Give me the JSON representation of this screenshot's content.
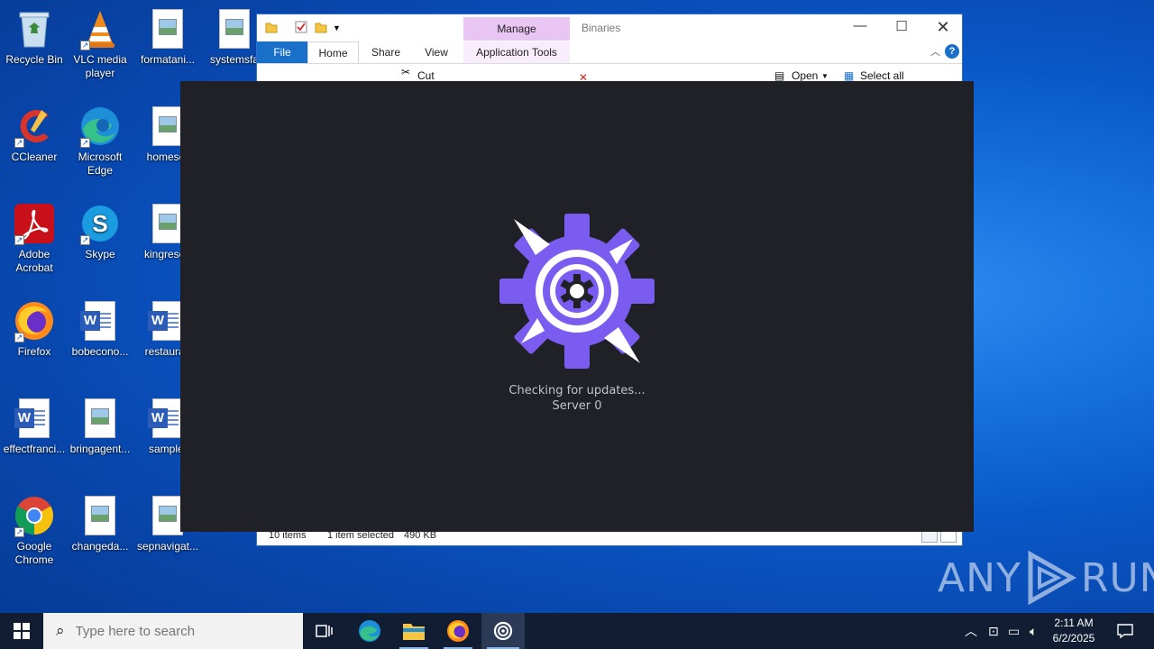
{
  "desktop": {
    "icons": [
      {
        "label": "Recycle Bin",
        "icon": "recycle-bin-icon"
      },
      {
        "label": "VLC media player",
        "icon": "vlc-icon"
      },
      {
        "label": "formatani...",
        "icon": "image-file-icon"
      },
      {
        "label": "systemsfa",
        "icon": "image-file-icon"
      },
      {
        "label": "CCleaner",
        "icon": "ccleaner-icon"
      },
      {
        "label": "Microsoft Edge",
        "icon": "edge-icon"
      },
      {
        "label": "homeser",
        "icon": "image-file-icon"
      },
      {
        "label": "Adobe Acrobat",
        "icon": "acrobat-icon"
      },
      {
        "label": "Skype",
        "icon": "skype-icon"
      },
      {
        "label": "kingresea",
        "icon": "image-file-icon"
      },
      {
        "label": "Firefox",
        "icon": "firefox-icon"
      },
      {
        "label": "bobecono...",
        "icon": "word-doc-icon"
      },
      {
        "label": "restauran",
        "icon": "word-doc-icon"
      },
      {
        "label": "effectfranci...",
        "icon": "word-doc-icon"
      },
      {
        "label": "bringagent...",
        "icon": "image-file-icon"
      },
      {
        "label": "samplef",
        "icon": "word-doc-icon"
      },
      {
        "label": "Google Chrome",
        "icon": "chrome-icon"
      },
      {
        "label": "changeda...",
        "icon": "image-file-icon"
      },
      {
        "label": "sepnavigat...",
        "icon": "image-file-icon"
      }
    ]
  },
  "explorer": {
    "title": "Binaries",
    "manage_tab": "Manage",
    "tabs": {
      "file": "File",
      "home": "Home",
      "share": "Share",
      "view": "View",
      "app_tools": "Application Tools"
    },
    "ribbon": {
      "cut": "Cut",
      "open": "Open",
      "select_all": "Select all"
    },
    "status": {
      "items": "10 items",
      "selected": "1 item selected",
      "size": "490 KB"
    }
  },
  "splash": {
    "status_line": "Checking for updates...",
    "server_line": "Server 0",
    "colors": {
      "background": "#1f2126",
      "logo": "#7b5cf0"
    }
  },
  "watermark": {
    "left": "ANY",
    "right": "RUN"
  },
  "taskbar": {
    "search_placeholder": "Type here to search",
    "time": "2:11 AM",
    "date": "6/2/2025"
  }
}
